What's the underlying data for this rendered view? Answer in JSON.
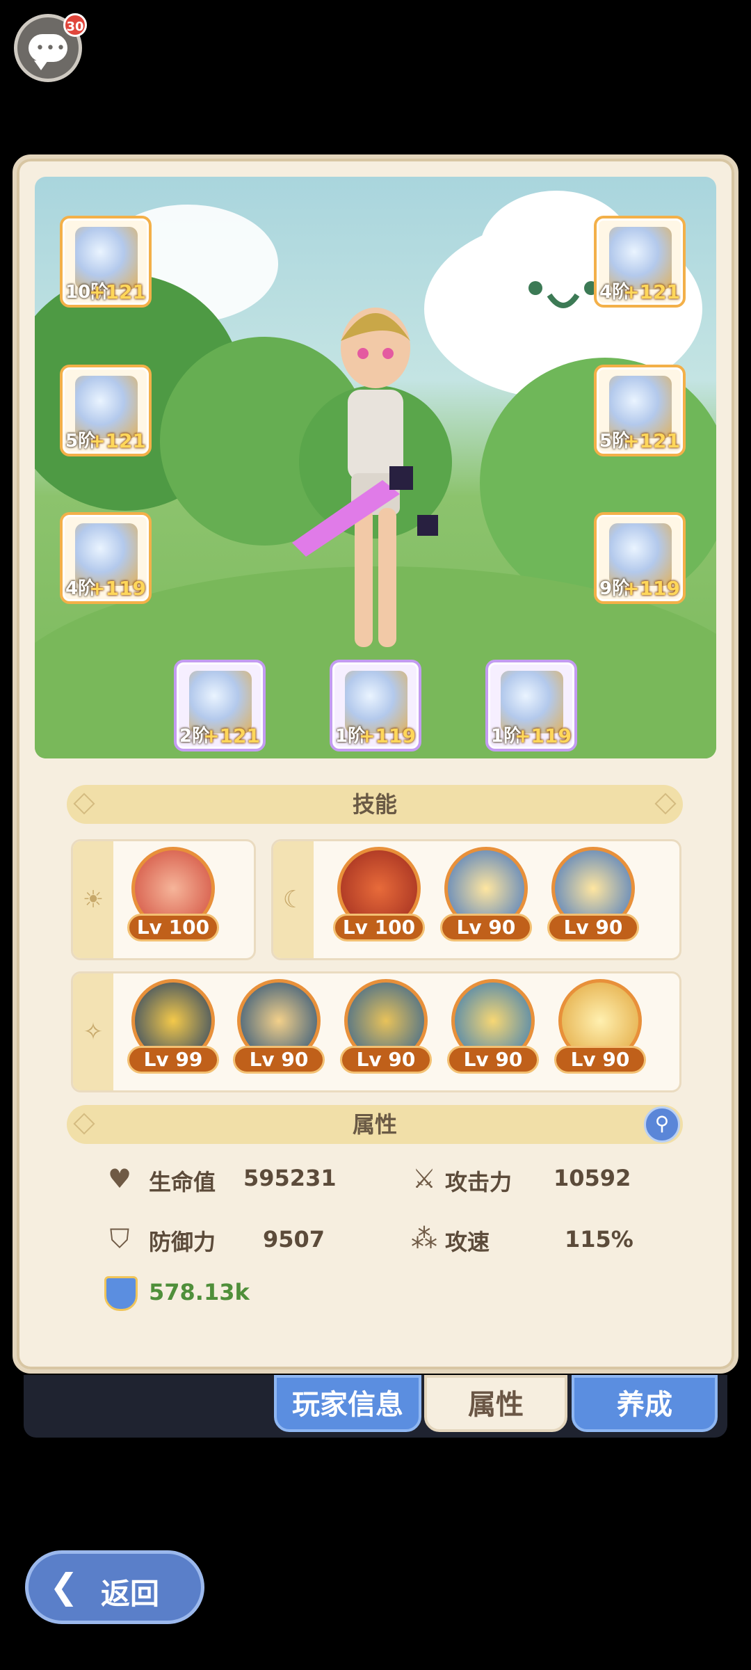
{
  "chat": {
    "badge_count": "30",
    "icon": "chat-bubble-icon"
  },
  "equipment": [
    {
      "slot": "weapon",
      "tier": "10阶",
      "plus": "+121",
      "frame": "orange"
    },
    {
      "slot": "helmet",
      "tier": "4阶",
      "plus": "+121",
      "frame": "orange"
    },
    {
      "slot": "chest",
      "tier": "5阶",
      "plus": "+121",
      "frame": "orange"
    },
    {
      "slot": "shoulder",
      "tier": "5阶",
      "plus": "+121",
      "frame": "orange"
    },
    {
      "slot": "legs",
      "tier": "4阶",
      "plus": "+119",
      "frame": "orange"
    },
    {
      "slot": "boots",
      "tier": "9阶",
      "plus": "+119",
      "frame": "orange"
    },
    {
      "slot": "ring",
      "tier": "2阶",
      "plus": "+121",
      "frame": "purple"
    },
    {
      "slot": "necklace",
      "tier": "1阶",
      "plus": "+119",
      "frame": "purple"
    },
    {
      "slot": "amulet",
      "tier": "1阶",
      "plus": "+119",
      "frame": "purple"
    }
  ],
  "skills": {
    "title": "技能",
    "sun_skills": [
      {
        "level": "Lv 100",
        "color": "#d04a3a"
      }
    ],
    "moon_skills": [
      {
        "level": "Lv 100",
        "color": "#9c2a1e"
      },
      {
        "level": "Lv 90",
        "color": "#3d72c2"
      },
      {
        "level": "Lv 90",
        "color": "#3d72c2"
      }
    ],
    "star_skills": [
      {
        "level": "Lv 99",
        "color": "#1d3a66"
      },
      {
        "level": "Lv 90",
        "color": "#1d4a78"
      },
      {
        "level": "Lv 90",
        "color": "#2a5e93"
      },
      {
        "level": "Lv 90",
        "color": "#2f77b8"
      },
      {
        "level": "Lv 90",
        "color": "#e0a43a"
      }
    ]
  },
  "attributes": {
    "title": "属性",
    "hp_label": "生命值",
    "hp_value": "595231",
    "atk_label": "攻击力",
    "atk_value": "10592",
    "def_label": "防御力",
    "def_value": "9507",
    "spd_label": "攻速",
    "spd_value": "115%",
    "power_value": "578.13k"
  },
  "tabs": {
    "player_info": "玩家信息",
    "attributes": "属性",
    "develop": "养成"
  },
  "back_label": "返回",
  "colors": {
    "accent_blue": "#5b8ee0",
    "panel_bg": "#f6eedf",
    "gold": "#f3b049",
    "power_green": "#4f8f3a"
  }
}
